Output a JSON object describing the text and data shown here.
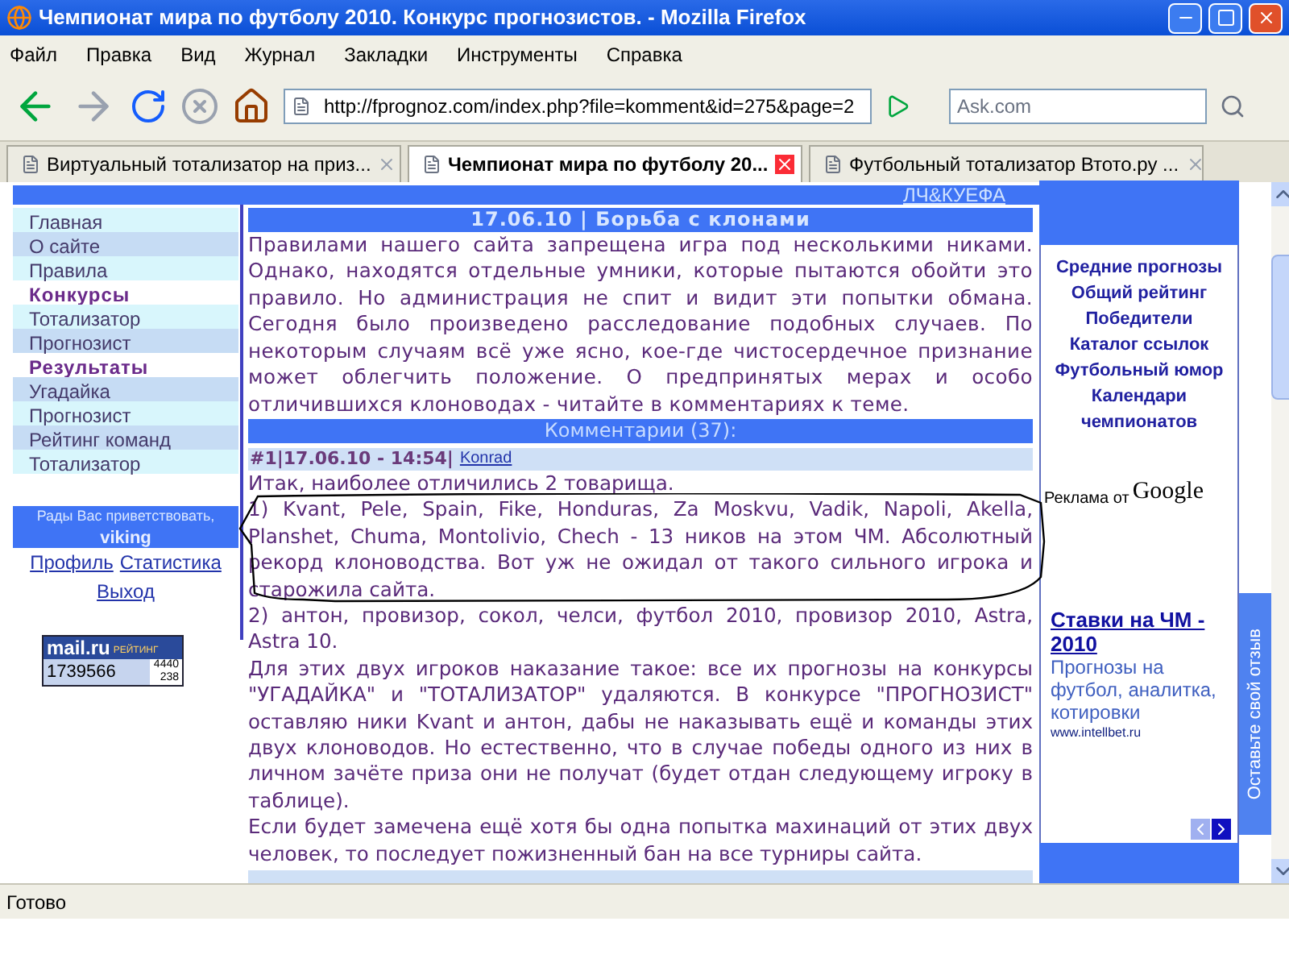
{
  "window": {
    "title": "Чемпионат мира по футболу 2010. Конкурс прогнозистов. - Mozilla Firefox"
  },
  "menu": [
    "Файл",
    "Правка",
    "Вид",
    "Журнал",
    "Закладки",
    "Инструменты",
    "Справка"
  ],
  "address": {
    "value": "http://fprognoz.com/index.php?file=komment&id=275&page=2"
  },
  "search": {
    "placeholder": "Ask.com"
  },
  "tabs": [
    {
      "label": "Виртуальный тотализатор на приз...",
      "selected": false
    },
    {
      "label": "Чемпионат мира по футболу 20...",
      "selected": true
    },
    {
      "label": "Футбольный тотализатор Втото.ру ...",
      "selected": false
    }
  ],
  "top_link": "ЛЧ&КУЕФА",
  "sidebar": {
    "items": [
      {
        "label": "Главная",
        "kind": "link"
      },
      {
        "label": "О сайте",
        "kind": "link"
      },
      {
        "label": "Правила",
        "kind": "link"
      },
      {
        "label": "Конкурсы",
        "kind": "heading"
      },
      {
        "label": "Тотализатор",
        "kind": "link"
      },
      {
        "label": "Прогнозист",
        "kind": "link"
      },
      {
        "label": "Результаты",
        "kind": "heading"
      },
      {
        "label": "Угадайка",
        "kind": "link"
      },
      {
        "label": "Прогнозист",
        "kind": "link"
      },
      {
        "label": "Рейтинг команд",
        "kind": "link"
      },
      {
        "label": "Тотализатор",
        "kind": "link"
      }
    ],
    "welcome": "Рады Вас приветствовать,",
    "user": "viking",
    "user_links": [
      "Профиль",
      "Статистика",
      "Выход"
    ],
    "counter": {
      "logo": "mail.ru",
      "label": "РЕЙТИНГ",
      "total": "1739566",
      "today": "4440",
      "online": "238"
    }
  },
  "article": {
    "header": "17.06.10 | Борьба с клонами",
    "text": "Правилами нашего сайта запрещена игра под несколькими никами. Однако, находятся отдельные умники, которые пытаются обойти это правило. Но администрация не спит и видит эти попытки обмана. Сегодня было произведено расследование подобных случаев. По некоторым случаям всё уже ясно, кое-где чистосердечное признание может облегчить положение. О предпринятых мерах и особо отличившихся клоноводах - читайте в комментариях к теме."
  },
  "comments": {
    "header": "Комментарии (37):",
    "items": [
      {
        "meta": "#1|17.06.10 - 14:54|",
        "author": "Konrad",
        "paragraphs": [
          {
            "text": "Итак, наиболее отличились 2 товарища.",
            "circled": false
          },
          {
            "text": "1) Kvant, Pele, Spain, Fike, Honduras, Za Moskvu, Vadik, Napoli, Akella, Planshet, Chuma, Montolivio, Chech - 13 ников на этом ЧМ. Абсолютный рекорд клоноводства. Вот уж не ожидал от такого сильного игрока и старожила сайта.",
            "circled": true
          },
          {
            "text": "2) антон, провизор, сокол, челси, футбол 2010, провизор 2010, Astra, Astra 10.",
            "circled": false
          },
          {
            "text": "Для этих двух игроков наказание такое: все их прогнозы на конкурсы \"УГАДАЙКА\" и \"ТОТАЛИЗАТОР\" удаляются. В конкурсе \"ПРОГНОЗИСТ\" оставляю ники Kvant и антон, дабы не наказывать ещё и команды этих двух клоноводов. Но естественно, что в случае победы одного из них в личном зачёте приза они не получат (будет отдан следующему игроку в таблице).",
            "circled": false
          },
          {
            "text": "Если будет замечена ещё хотя бы одна попытка махинаций от этих двух человек, то последует пожизненный бан на все турниры сайта.",
            "circled": false
          }
        ]
      }
    ]
  },
  "right": {
    "links": [
      "Средние прогнозы",
      "Общий рейтинг",
      "Победители",
      "Каталог ссылок",
      "Футбольный юмор",
      "Календари чемпионатов"
    ],
    "ads_label": "Реклама от",
    "ads_brand": "Google",
    "ad": {
      "title": "Ставки на ЧМ - 2010",
      "text": "Прогнозы на футбол, аналитка, котировки",
      "url": "www.intellbet.ru"
    }
  },
  "feedback": "Оставьте свой отзыв",
  "status_bar": "Готово"
}
